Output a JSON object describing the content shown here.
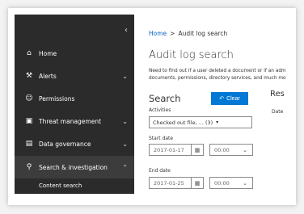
{
  "sidebar": {
    "collapse_icon": "chevron-left-icon",
    "items": [
      {
        "label": "Home",
        "icon": "home-icon",
        "expandable": false
      },
      {
        "label": "Alerts",
        "icon": "wrench-icon",
        "expandable": true
      },
      {
        "label": "Permissions",
        "icon": "people-icon",
        "expandable": false
      },
      {
        "label": "Threat management",
        "icon": "lock-icon",
        "expandable": true
      },
      {
        "label": "Data governance",
        "icon": "data-governance-icon",
        "expandable": true
      },
      {
        "label": "Search & investigation",
        "icon": "search-icon",
        "expandable": true,
        "expanded": true
      }
    ],
    "subitems": [
      {
        "label": "Content search"
      }
    ]
  },
  "breadcrumb": {
    "home": "Home",
    "separator": ">",
    "current": "Audit log search"
  },
  "page": {
    "title": "Audit log search",
    "description_line1": "Need to find out if a user deleted a document or if an admi",
    "description_line2": "documents, permissions, directory services, and much more"
  },
  "search": {
    "heading": "Search",
    "clear_label": "Clear",
    "activities_label": "Activities",
    "activities_value": "Checked out file, ... (3)",
    "start_date_label": "Start date",
    "start_date_value": "2017-01-17",
    "start_time_value": "00:00",
    "end_date_label": "End date",
    "end_date_value": "2017-01-25",
    "end_time_value": "00:00"
  },
  "results": {
    "heading": "Res",
    "date_column": "Date"
  },
  "colors": {
    "sidebar_bg": "#2b2b2b",
    "accent": "#0078d4",
    "link": "#0b62c4"
  }
}
